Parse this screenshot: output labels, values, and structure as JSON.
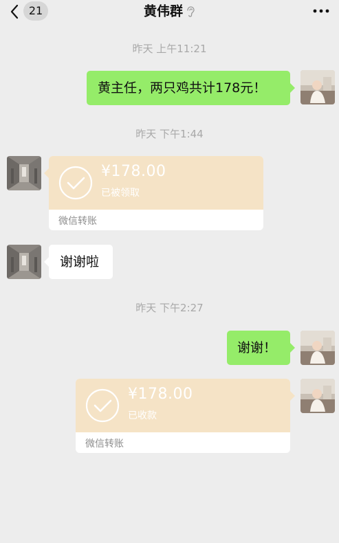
{
  "header": {
    "back_count": "21",
    "title": "黄伟群"
  },
  "messages": {
    "ts1": "昨天 上午11:21",
    "msg1": "黄主任，两只鸡共计178元！",
    "ts2": "昨天 下午1:44",
    "transfer1": {
      "amount": "¥178.00",
      "status": "已被领取",
      "footer": "微信转账"
    },
    "msg2": "谢谢啦",
    "ts3": "昨天 下午2:27",
    "msg3": "谢谢！",
    "transfer2": {
      "amount": "¥178.00",
      "status": "已收款",
      "footer": "微信转账"
    }
  },
  "colors": {
    "background": "#ededed",
    "outgoing_bubble": "#95ec69",
    "incoming_bubble": "#ffffff",
    "transfer_card": "#f5e3c6"
  },
  "icons": [
    "back-chevron-icon",
    "ear-icon",
    "more-icon",
    "check-circle-icon"
  ]
}
